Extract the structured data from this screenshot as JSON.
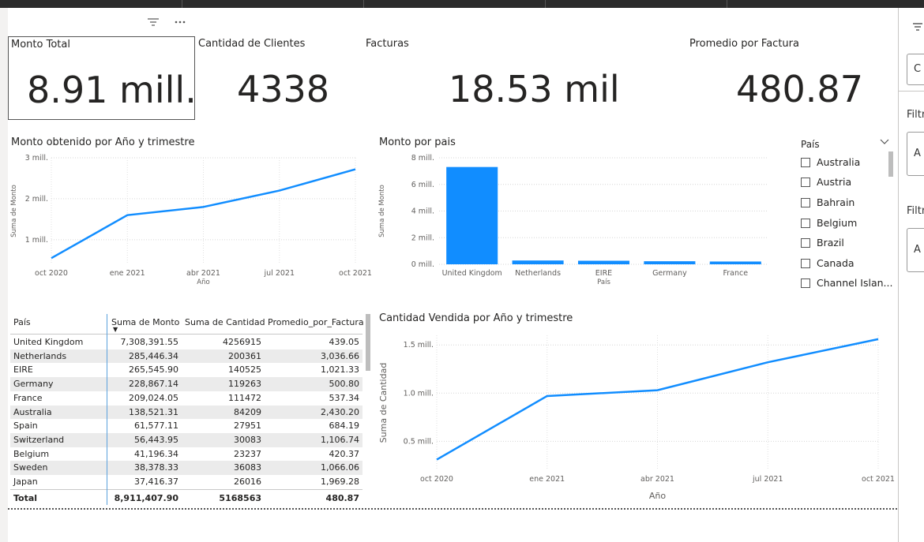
{
  "toolbar": {
    "filter_icon": "filter-icon",
    "more_icon": "more-options-icon"
  },
  "cards": [
    {
      "label": "Monto Total",
      "value": "8.91 mill."
    },
    {
      "label": "Cantidad de Clientes",
      "value": "4338"
    },
    {
      "label": "Facturas",
      "value": "18.53 mil"
    },
    {
      "label": "Promedio por Factura",
      "value": "480.87"
    }
  ],
  "chart_data": [
    {
      "type": "line",
      "title": "Monto obtenido por Año y trimestre",
      "xlabel": "Año",
      "ylabel": "Suma de Monto",
      "x": [
        "oct 2020",
        "ene 2021",
        "abr 2021",
        "jul 2021",
        "oct 2021"
      ],
      "values": [
        0.55,
        1.6,
        1.8,
        2.2,
        2.72
      ],
      "y_ticks": [
        "1 mill.",
        "2 mill.",
        "3 mill."
      ],
      "y_tick_values": [
        1,
        2,
        3
      ],
      "ylim": [
        0.4,
        3
      ],
      "color": "#118dff",
      "grid": true
    },
    {
      "type": "bar",
      "title": "Monto por pais",
      "xlabel": "País",
      "ylabel": "Suma de Monto",
      "categories": [
        "United Kingdom",
        "Netherlands",
        "EIRE",
        "Germany",
        "France"
      ],
      "values": [
        7.308,
        0.285,
        0.266,
        0.229,
        0.209
      ],
      "y_ticks": [
        "0 mill.",
        "2 mill.",
        "4 mill.",
        "6 mill.",
        "8 mill."
      ],
      "y_tick_values": [
        0,
        2,
        4,
        6,
        8
      ],
      "ylim": [
        0,
        8
      ],
      "color": "#118dff",
      "grid": true
    },
    {
      "type": "line",
      "title": "Cantidad Vendida por Año y trimestre",
      "xlabel": "Año",
      "ylabel": "Suma de Cantidad",
      "x": [
        "oct 2020",
        "ene 2021",
        "abr 2021",
        "jul 2021",
        "oct 2021"
      ],
      "values": [
        0.31,
        0.97,
        1.03,
        1.32,
        1.56
      ],
      "y_ticks": [
        "0.5 mill.",
        "1.0 mill.",
        "1.5 mill."
      ],
      "y_tick_values": [
        0.5,
        1.0,
        1.5
      ],
      "ylim": [
        0.2,
        1.6
      ],
      "color": "#118dff",
      "grid": true
    }
  ],
  "slicer": {
    "title": "País",
    "items": [
      "Australia",
      "Austria",
      "Bahrain",
      "Belgium",
      "Brazil",
      "Canada",
      "Channel Islan..."
    ]
  },
  "table": {
    "columns": [
      "País",
      "Suma de Monto",
      "Suma de Cantidad",
      "Promedio_por_Factura"
    ],
    "rows": [
      [
        "United Kingdom",
        "7,308,391.55",
        "4256915",
        "439.05"
      ],
      [
        "Netherlands",
        "285,446.34",
        "200361",
        "3,036.66"
      ],
      [
        "EIRE",
        "265,545.90",
        "140525",
        "1,021.33"
      ],
      [
        "Germany",
        "228,867.14",
        "119263",
        "500.80"
      ],
      [
        "France",
        "209,024.05",
        "111472",
        "537.34"
      ],
      [
        "Australia",
        "138,521.31",
        "84209",
        "2,430.20"
      ],
      [
        "Spain",
        "61,577.11",
        "27951",
        "684.19"
      ],
      [
        "Switzerland",
        "56,443.95",
        "30083",
        "1,106.74"
      ],
      [
        "Belgium",
        "41,196.34",
        "23237",
        "420.37"
      ],
      [
        "Sweden",
        "38,378.33",
        "36083",
        "1,066.06"
      ],
      [
        "Japan",
        "37,416.37",
        "26016",
        "1,969.28"
      ]
    ],
    "total": [
      "Total",
      "8,911,407.90",
      "5168563",
      "480.87"
    ]
  },
  "right_panel": {
    "filter_label_1": "Filtr",
    "filter_label_2": "Filtr",
    "box_1": "A",
    "box_2": "A",
    "search_box": "C"
  }
}
